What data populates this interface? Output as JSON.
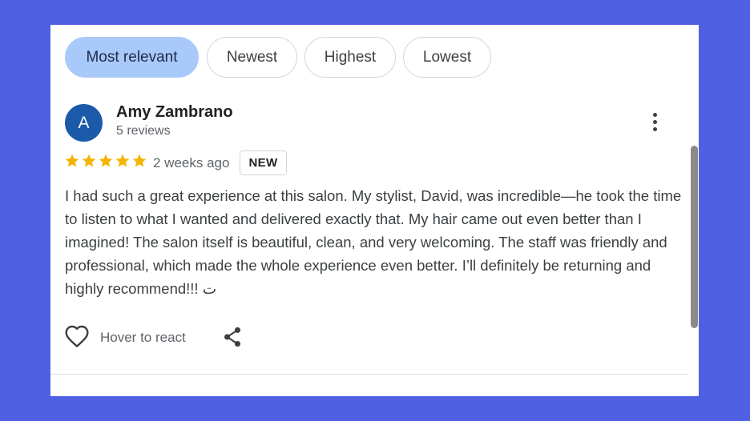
{
  "sort_chips": [
    {
      "label": "Most relevant"
    },
    {
      "label": "Newest"
    },
    {
      "label": "Highest"
    },
    {
      "label": "Lowest"
    }
  ],
  "review": {
    "avatar_initial": "A",
    "author_name": "Amy Zambrano",
    "author_reviews": "5 reviews",
    "rating": 5,
    "rating_max": 5,
    "time_ago": "2 weeks ago",
    "badge": "NEW",
    "text": "I had such a great experience at this salon. My stylist, David, was incredible—he took the time to listen to what I wanted and delivered exactly that. My hair came out even better than I imagined! The salon itself is beautiful, clean, and very welcoming. The staff was friendly and professional, which made the whole experience even better. I’ll definitely be returning and highly recommend!!! ت",
    "react_label": "Hover to react"
  },
  "icons": {
    "star": "star-icon",
    "more": "more-vert-icon",
    "heart": "heart-icon",
    "share": "share-icon"
  },
  "colors": {
    "background": "#4f60e2",
    "chip_active": "#a9c9fb",
    "avatar": "#1a5aa8",
    "star": "#f5b400"
  }
}
